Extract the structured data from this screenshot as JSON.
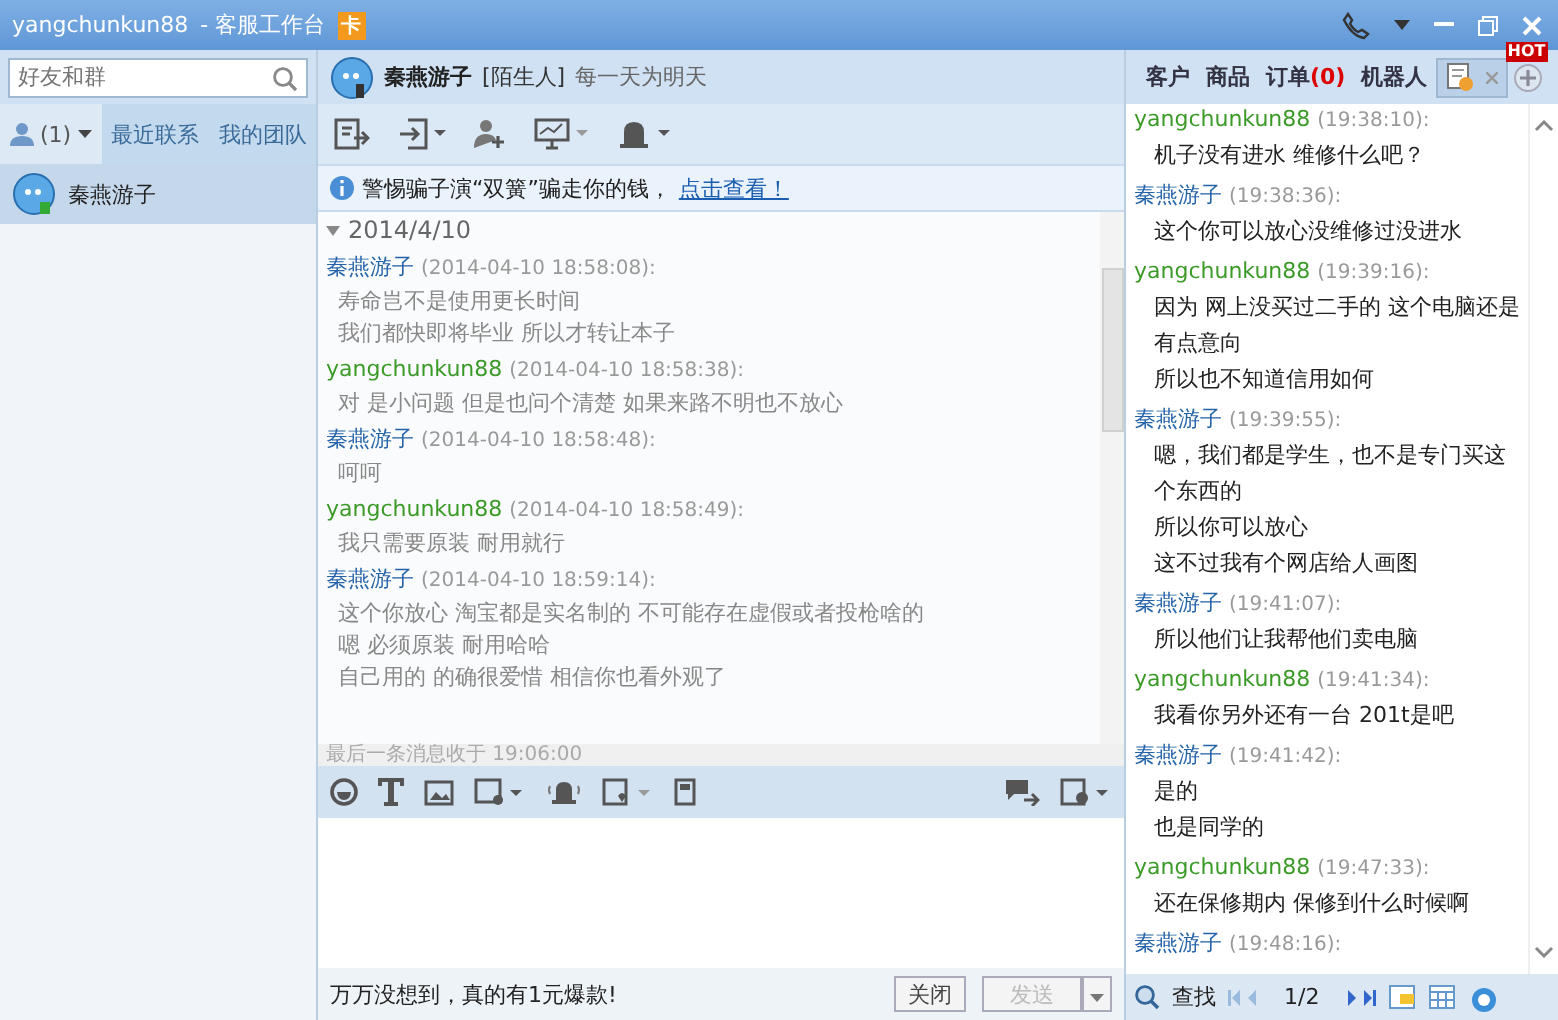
{
  "window": {
    "user": "yangchunkun88",
    "title": "- 客服工作台",
    "badge": "卡"
  },
  "sidebar": {
    "search": {
      "placeholder": "好友和群"
    },
    "tabs": [
      {
        "kind": "contacts",
        "label": "(1)",
        "selected": true
      },
      {
        "kind": "text",
        "label": "最近联系",
        "selected": false
      },
      {
        "kind": "text",
        "label": "我的团队",
        "selected": false
      }
    ],
    "contacts": [
      {
        "name": "秦燕游子",
        "selected": true
      }
    ]
  },
  "chat": {
    "header": {
      "name": "秦燕游子",
      "tag": "[陌生人]",
      "signature": "每一天为明天"
    },
    "notice": {
      "text": "警惕骗子演“双簧”骗走你的钱，",
      "link": "点击查看！"
    },
    "history": {
      "date": "2014/4/10",
      "messages": [
        {
          "kind": "contact",
          "sender": "秦燕游子",
          "time": "(2014-04-10 18:58:08):",
          "lines": [
            "寿命岂不是使用更长时间",
            "我们都快即将毕业  所以才转让本子"
          ]
        },
        {
          "kind": "self",
          "sender": "yangchunkun88",
          "time": "(2014-04-10 18:58:38):",
          "lines": [
            "对  是小问题  但是也问个清楚  如果来路不明也不放心"
          ]
        },
        {
          "kind": "contact",
          "sender": "秦燕游子",
          "time": "(2014-04-10 18:58:48):",
          "lines": [
            "呵呵"
          ]
        },
        {
          "kind": "self",
          "sender": "yangchunkun88",
          "time": "(2014-04-10 18:58:49):",
          "lines": [
            "我只需要原装 耐用就行"
          ]
        },
        {
          "kind": "contact",
          "sender": "秦燕游子",
          "time": "(2014-04-10 18:59:14):",
          "lines": [
            "这个你放心 淘宝都是实名制的 不可能存在虚假或者投枪啥的",
            "嗯 必须原装 耐用哈哈",
            "自己用的 的确很爱惜 相信你也看外观了"
          ]
        }
      ],
      "last_received": "最后一条消息收于 19:06:00"
    },
    "promo": "万万没想到，真的有1元爆款!",
    "buttons": [
      {
        "kind": "close",
        "label": "关闭",
        "disabled": false
      },
      {
        "kind": "send",
        "label": "发送",
        "disabled": true
      }
    ]
  },
  "side_panel": {
    "tabs": [
      {
        "label": "客户"
      },
      {
        "label": "商品"
      },
      {
        "label": "订单",
        "count": "(0)"
      },
      {
        "label": "机器人"
      }
    ],
    "hot_badge": "HOT",
    "messages": [
      {
        "kind": "self",
        "sender": "yangchunkun88",
        "time": "(19:38:10):",
        "lines": [
          "机子没有进水  维修什么吧？"
        ]
      },
      {
        "kind": "contact",
        "sender": "秦燕游子",
        "time": "(19:38:36):",
        "lines": [
          "这个你可以放心没维修过没进水"
        ]
      },
      {
        "kind": "self",
        "sender": "yangchunkun88",
        "time": "(19:39:16):",
        "lines": [
          "因为  网上没买过二手的    这个电脑还是有点意向",
          "所以也不知道信用如何"
        ]
      },
      {
        "kind": "contact",
        "sender": "秦燕游子",
        "time": "(19:39:55):",
        "lines": [
          "嗯，我们都是学生，也不是专门买这个东西的",
          "所以你可以放心",
          "这不过我有个网店给人画图"
        ]
      },
      {
        "kind": "contact",
        "sender": "秦燕游子",
        "time": "(19:41:07):",
        "lines": [
          "所以他们让我帮他们卖电脑"
        ]
      },
      {
        "kind": "self",
        "sender": "yangchunkun88",
        "time": "(19:41:34):",
        "lines": [
          "我看你另外还有一台 201t是吧"
        ]
      },
      {
        "kind": "contact",
        "sender": "秦燕游子",
        "time": "(19:41:42):",
        "lines": [
          "是的",
          "也是同学的"
        ]
      },
      {
        "kind": "self",
        "sender": "yangchunkun88",
        "time": "(19:47:33):",
        "lines": [
          "还在保修期内  保修到什么时候啊"
        ]
      },
      {
        "kind": "contact",
        "sender": "秦燕游子",
        "time": "(19:48:16):"
      }
    ],
    "find": "查找",
    "page": "1/2"
  }
}
